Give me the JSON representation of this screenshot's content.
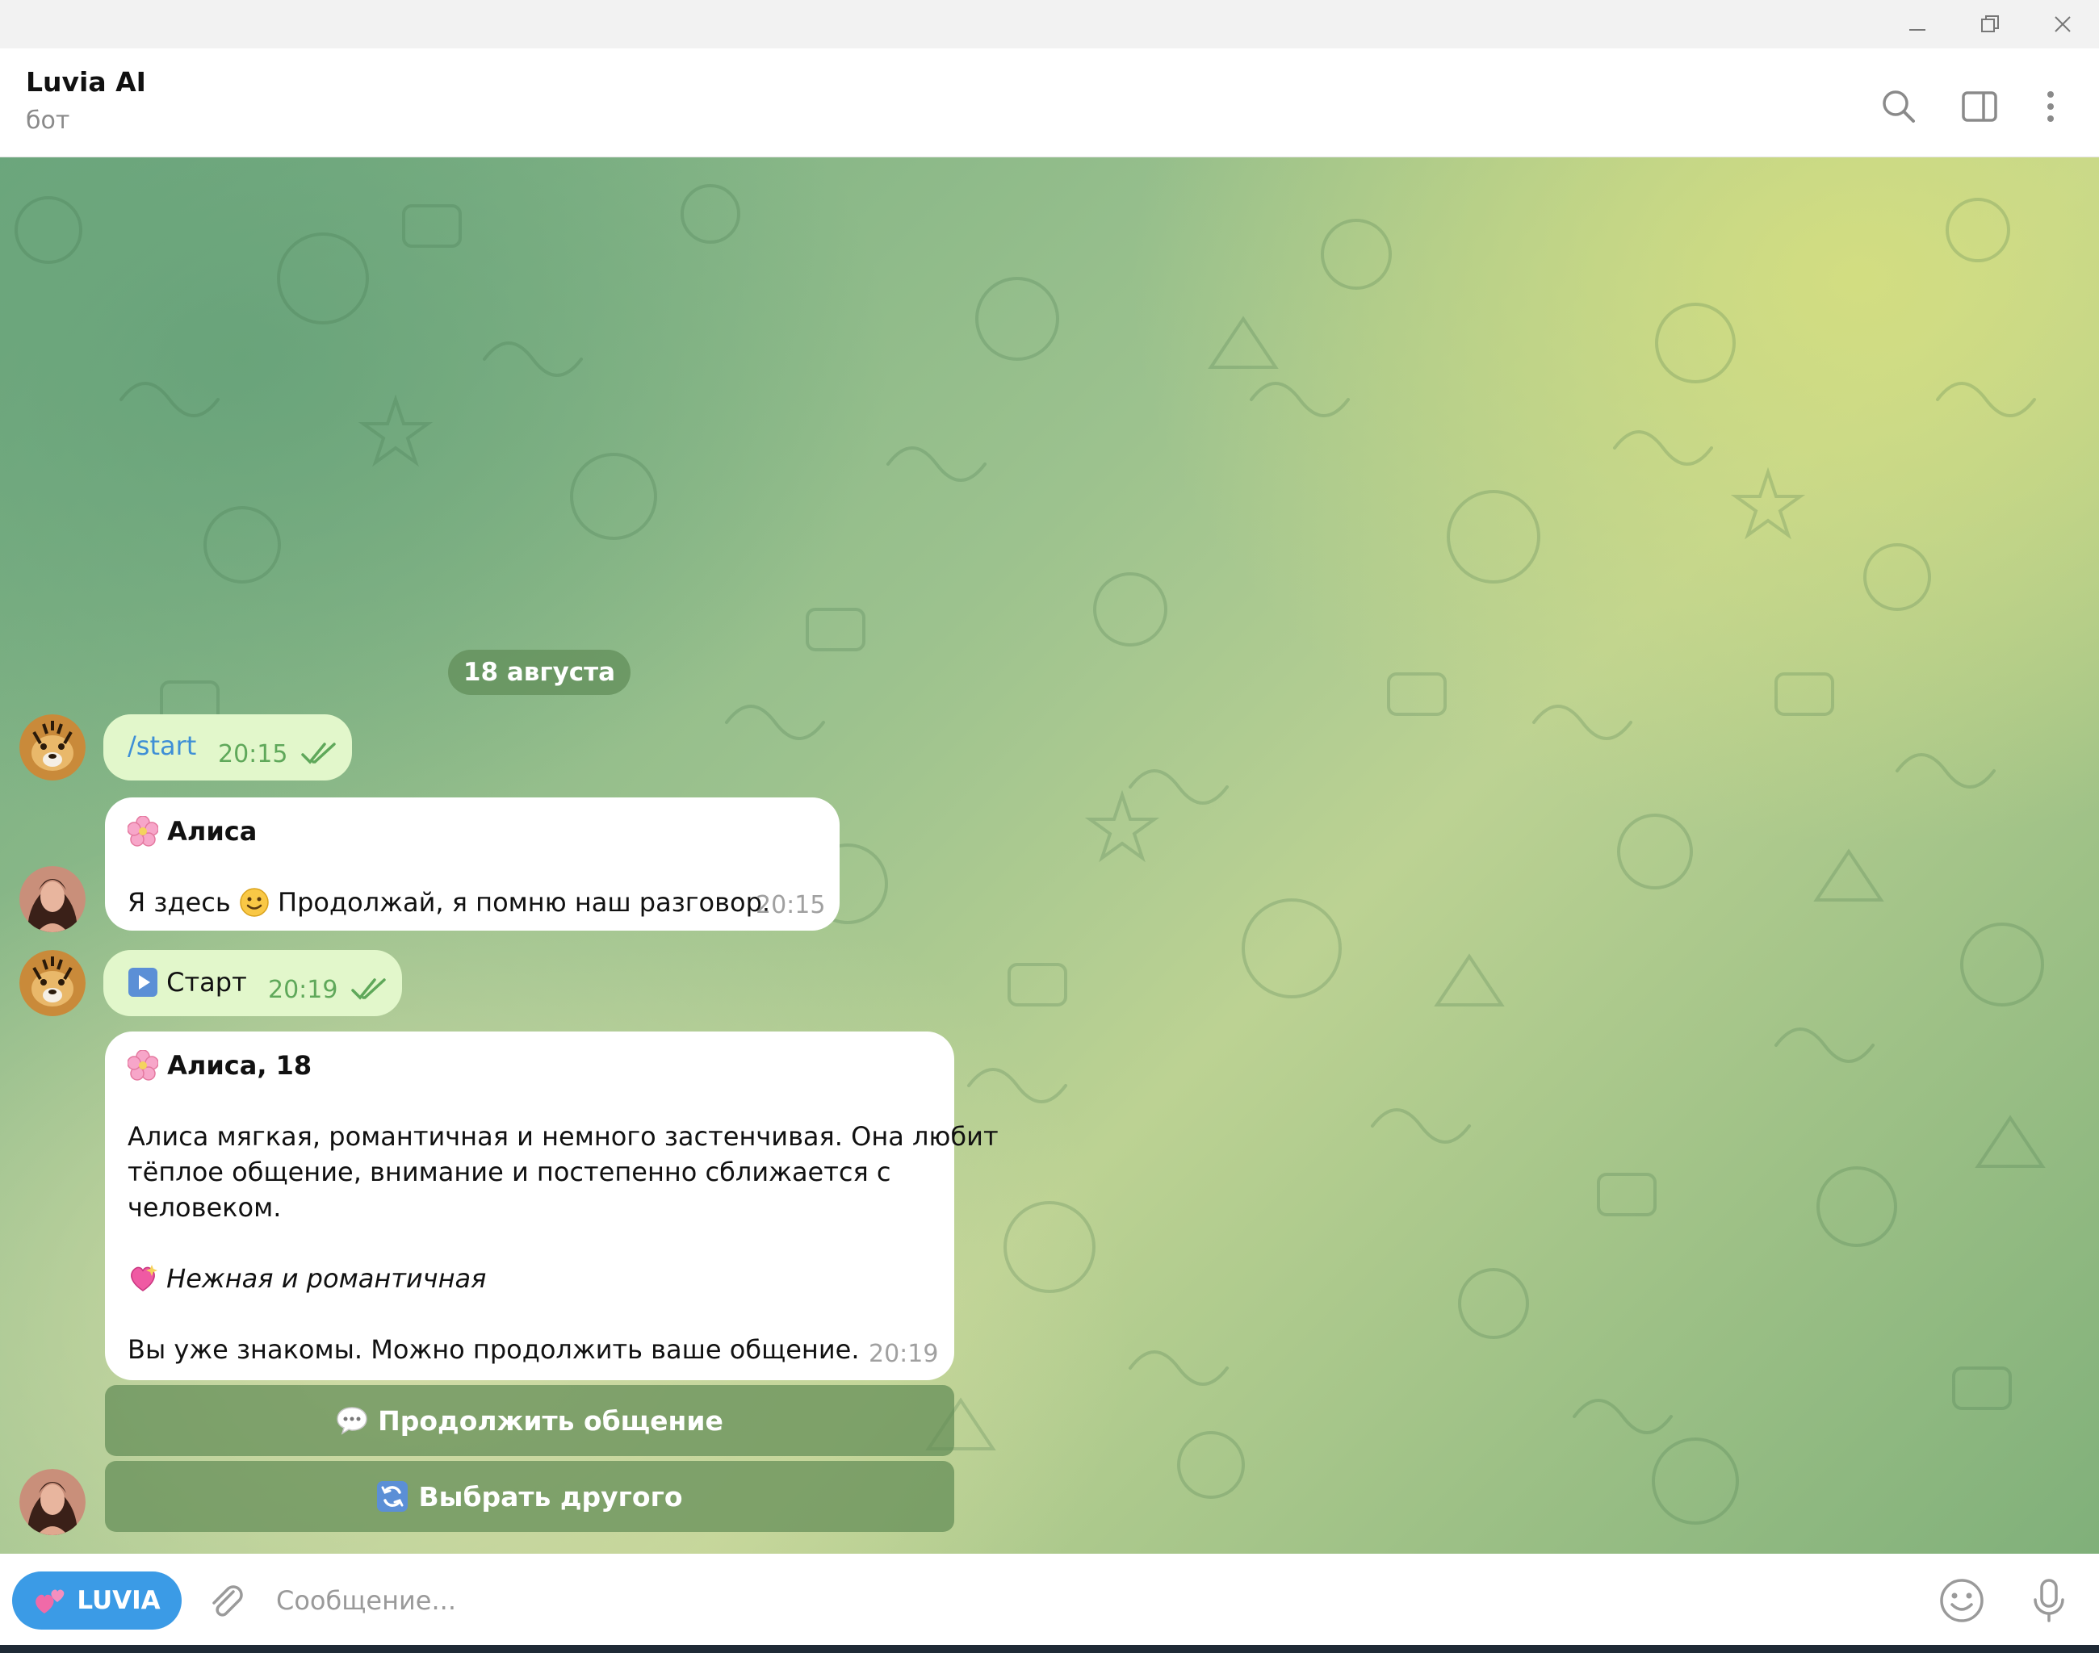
{
  "window": {
    "minimize_icon": "minimize-icon",
    "restore_icon": "restore-icon",
    "close_icon": "close-icon"
  },
  "header": {
    "title": "Luvia AI",
    "subtitle": "бот",
    "icons": [
      "search-icon",
      "sidebar-toggle-icon",
      "more-vertical-icon"
    ]
  },
  "chat": {
    "date_pill": "18 августа",
    "messages": [
      {
        "type": "outgoing",
        "text": "/start",
        "time": "20:15",
        "status_icon": "double-check-icon"
      },
      {
        "type": "incoming",
        "title": "Алиса",
        "title_icon": "cherry-blossom-icon",
        "text_a": "Я здесь",
        "text_b": "Продолжай, я помню наш разговор.",
        "inline_icon": "slight-smile-icon",
        "time": "20:15"
      },
      {
        "type": "outgoing",
        "text": "Старт",
        "lead_icon": "play-button-icon",
        "time": "20:19",
        "status_icon": "double-check-icon"
      },
      {
        "type": "incoming",
        "title": "Алиса, 18",
        "title_icon": "cherry-blossom-icon",
        "desc_line1": "Алиса мягкая, романтичная и немного застенчивая. Она любит",
        "desc_line2": "тёплое общение, внимание и постепенно сближается с",
        "desc_line3": "человеком.",
        "tag": "Нежная и романтичная",
        "tag_icon": "sparkling-heart-icon",
        "footer": "Вы уже знакомы. Можно продолжить ваше общение.",
        "time": "20:19"
      }
    ],
    "keyboard": [
      {
        "label": "Продолжить общение",
        "icon": "speech-bubble-icon"
      },
      {
        "label": "Выбрать другого",
        "icon": "refresh-icon"
      }
    ]
  },
  "composer": {
    "menu_button": "LUVIA",
    "menu_icon": "two-hearts-icon",
    "placeholder": "Сообщение...",
    "icons": [
      "attach-icon",
      "emoji-icon",
      "microphone-icon"
    ]
  },
  "colors": {
    "outgoing_bubble": "#e2f7cb",
    "incoming_bubble": "#ffffff",
    "accent": "#3b9be6",
    "time_outgoing": "#5fa85a",
    "link": "#3e8fd6"
  }
}
